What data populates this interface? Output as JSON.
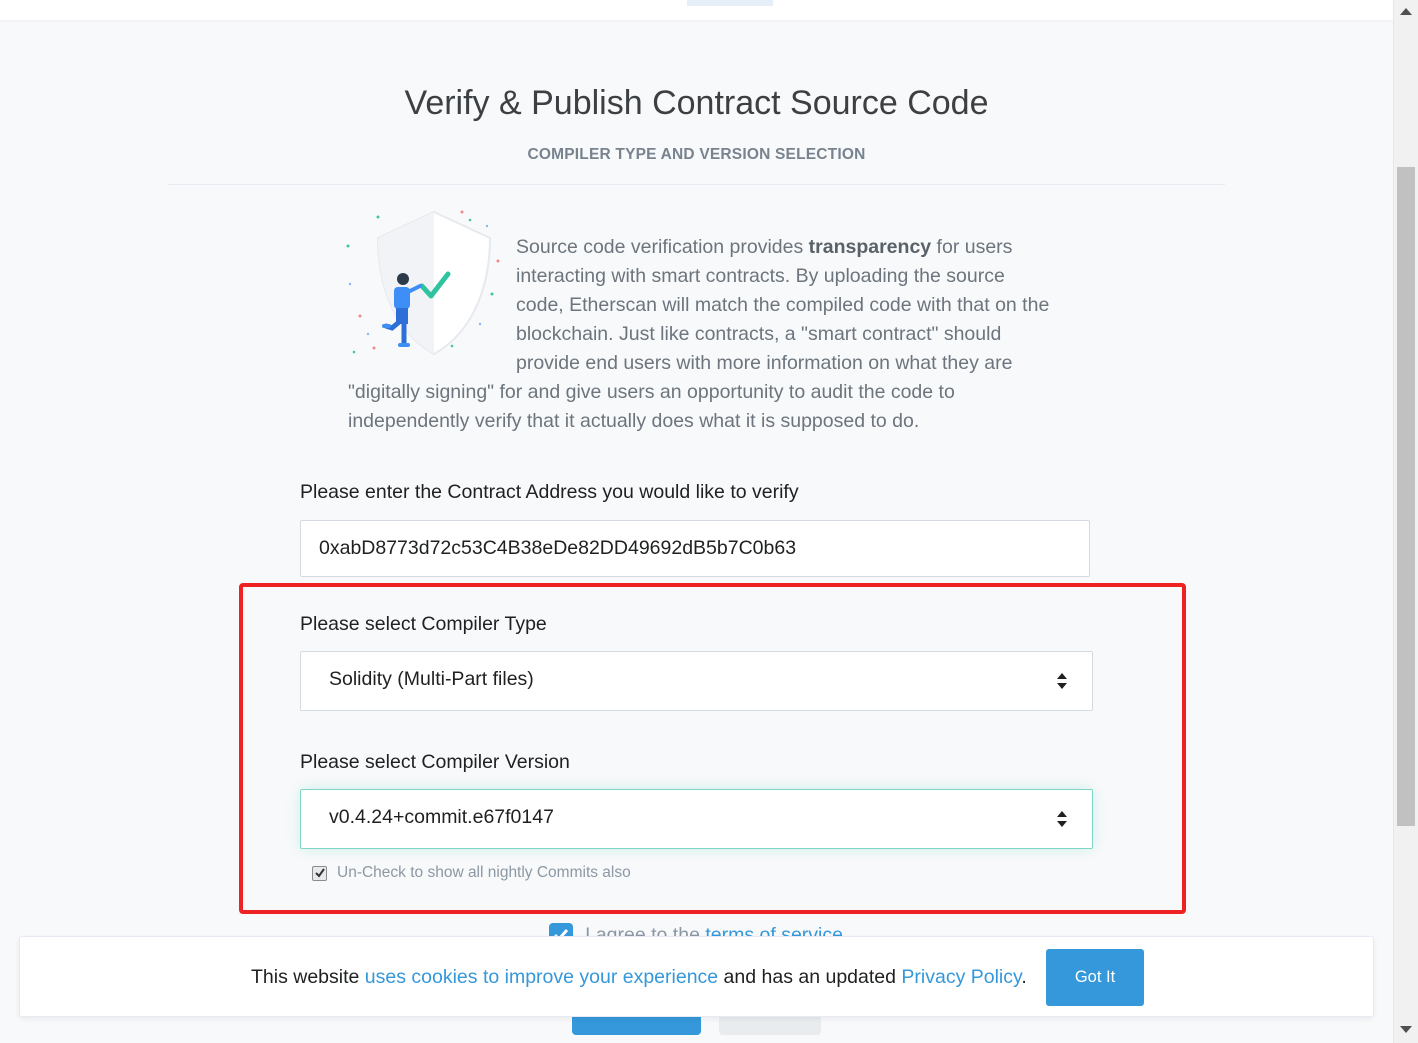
{
  "page": {
    "title": "Verify & Publish Contract Source Code",
    "subtitle": "COMPILER TYPE AND VERSION SELECTION"
  },
  "intro": {
    "text_before": "Source code verification provides ",
    "text_bold": "transparency",
    "text_after": " for users interacting with smart contracts. By uploading the source code, Etherscan will match the compiled code with that on the blockchain. Just like contracts, a \"smart contract\" should provide end users with more information on what they are \"digitally signing\" for and give users an opportunity to audit the code to independently verify that it actually does what it is supposed to do."
  },
  "form": {
    "address_label": "Please enter the Contract Address you would like to verify",
    "address_value": "0xabD8773d72c53C4B38eDe82DD49692dB5b7C0b63",
    "compiler_type_label": "Please select Compiler Type",
    "compiler_type_value": "Solidity (Multi-Part files)",
    "compiler_version_label": "Please select Compiler Version",
    "compiler_version_value": "v0.4.24+commit.e67f0147",
    "nightly_checkbox_label": "Un-Check to show all nightly Commits also",
    "nightly_checked": true,
    "agree_text": "I agree to the ",
    "agree_link": "terms of service"
  },
  "cookie_banner": {
    "text_1": "This website ",
    "link_1": "uses cookies to improve your experience",
    "text_2": " and has an updated ",
    "link_2": "Privacy Policy",
    "text_3": ".",
    "button_label": "Got It"
  },
  "icons": {
    "illustration": "shield-verification-illustration",
    "select_arrows": "sort-arrows-icon",
    "check": "checkmark-icon"
  },
  "colors": {
    "accent": "#3498db",
    "highlight_border": "#ee2222",
    "focus_border": "#7fd6c6"
  }
}
